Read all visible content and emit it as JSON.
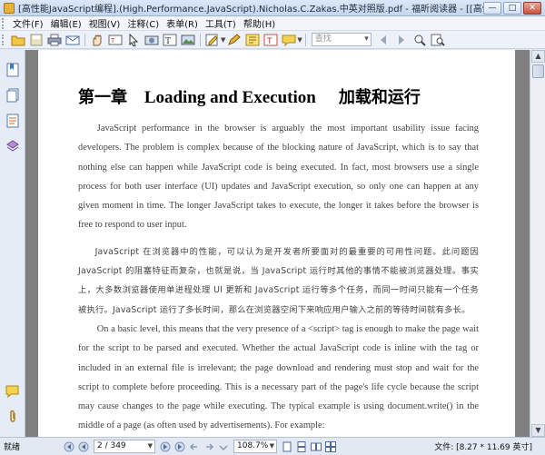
{
  "window": {
    "title": "[高性能JavaScript编程].(High.Performance.JavaScript).Nicholas.C.Zakas.中英对照版.pdf - 福昕阅读器 - [[高性能JavaScript编程].(High.Performa...",
    "minimize": "—",
    "maximize": "□",
    "close": "✕"
  },
  "menu": {
    "items": [
      "文件(F)",
      "编辑(E)",
      "视图(V)",
      "注释(C)",
      "表单(R)",
      "工具(T)",
      "帮助(H)"
    ]
  },
  "toolbar": {
    "search_placeholder": "查找"
  },
  "document": {
    "chapter_zh": "第一章",
    "chapter_en": "Loading and Execution",
    "chapter_zh2": "加载和运行",
    "paragraphs": [
      "JavaScript performance in the browser is arguably the most important usability issue facing developers. The problem is complex because of the blocking nature of JavaScript, which is to say that nothing else can happen while JavaScript code is being executed. In fact, most browsers use a single process for both user interface (UI) updates and JavaScript execution, so only one can happen at any given moment in time. The longer JavaScript takes to execute, the longer it takes before the browser is free to respond to user input.",
      "JavaScript 在浏览器中的性能，可以认为是开发者所要面对的最重要的可用性问题。此问题因 JavaScript 的阻塞特征而复杂，也就是说，当 JavaScript 运行时其他的事情不能被浏览器处理。事实上，大多数浏览器使用单进程处理 UI 更新和 JavaScript 运行等多个任务，而同一时间只能有一个任务被执行。JavaScript 运行了多长时间，那么在浏览器空闲下来响应用户输入之前的等待时间就有多长。",
      "On a basic level, this means that the very presence of a <script> tag is enough to make the page wait for the script to be parsed and executed. Whether the actual JavaScript code is inline with the tag or included in an external file is irrelevant; the page download and rendering must stop and wait for the script to complete before proceeding. This is a necessary part of the page's life cycle because the script may cause changes to the page while executing. The typical example is using document.write() in the middle of a page (as often used by advertisements). For example:"
    ]
  },
  "status": {
    "ready": "就绪",
    "page_indicator": "2 / 349",
    "zoom": "108.7%",
    "file_info": "文件: [8.27 * 11.69 英寸]"
  }
}
